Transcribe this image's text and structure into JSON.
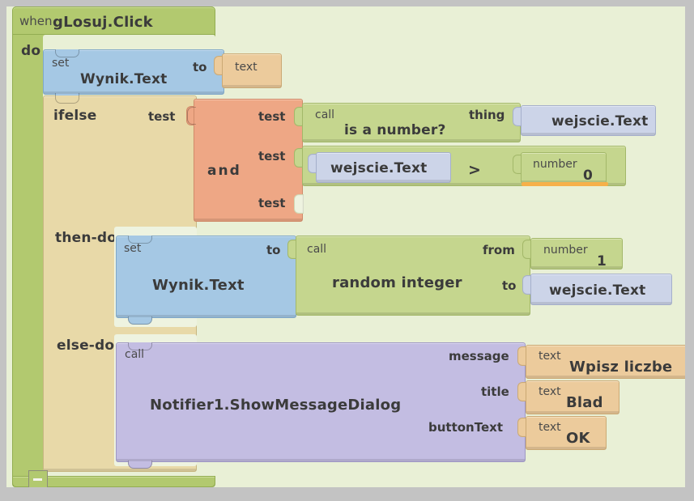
{
  "workspace": {
    "background_color": "#e9f0d6",
    "outer_color": "#c3c3c3"
  },
  "event_block": {
    "keyword": "when",
    "name": "gLosuj.Click",
    "body_label": "do",
    "color": "#b2c96f"
  },
  "set_wynik_empty": {
    "keyword": "set",
    "name": "Wynik.Text",
    "to_label": "to",
    "color": "#a5c8e4",
    "value": {
      "keyword": "text",
      "content": "",
      "color": "#eccb9c"
    }
  },
  "ifelse_block": {
    "name": "ifelse",
    "test_label": "test",
    "then_label": "then-do",
    "else_label": "else-do",
    "color": "#e8d9a8",
    "collapse_icon": "minus-icon"
  },
  "and_block": {
    "name": "and",
    "socket_labels": [
      "test",
      "test",
      "test"
    ],
    "color": "#eea785",
    "tests": [
      {
        "type": "call",
        "keyword": "call",
        "name": "is a number?",
        "arg_label": "thing",
        "color": "#c5d68e",
        "arg": {
          "name": "wejscie.Text",
          "color": "#ccd4e8"
        }
      },
      {
        "type": "compare",
        "operator": ">",
        "color": "#c5d68e",
        "left": {
          "name": "wejscie.Text",
          "color": "#ccd4e8"
        },
        "right": {
          "keyword": "number",
          "value": "0",
          "color": "#c5d68e",
          "selected": true,
          "highlight_color": "#f6b04a"
        }
      },
      {
        "type": "empty"
      }
    ]
  },
  "then_branch": {
    "set_block": {
      "keyword": "set",
      "name": "Wynik.Text",
      "to_label": "to",
      "color": "#a5c8e4"
    },
    "random_block": {
      "keyword": "call",
      "name": "random integer",
      "from_label": "from",
      "to_label": "to",
      "color": "#c5d68e",
      "from_value": {
        "keyword": "number",
        "value": "1",
        "color": "#c5d68e"
      },
      "to_value": {
        "name": "wejscie.Text",
        "color": "#ccd4e8"
      }
    }
  },
  "else_branch": {
    "notifier": {
      "keyword": "call",
      "name": "Notifier1.ShowMessageDialog",
      "color": "#c3bde2",
      "args": [
        {
          "label": "message",
          "keyword": "text",
          "value": "Wpisz liczbe",
          "color": "#eccb9c"
        },
        {
          "label": "title",
          "keyword": "text",
          "value": "Blad",
          "color": "#eccb9c"
        },
        {
          "label": "buttonText",
          "keyword": "text",
          "value": "OK",
          "color": "#eccb9c"
        }
      ]
    }
  }
}
